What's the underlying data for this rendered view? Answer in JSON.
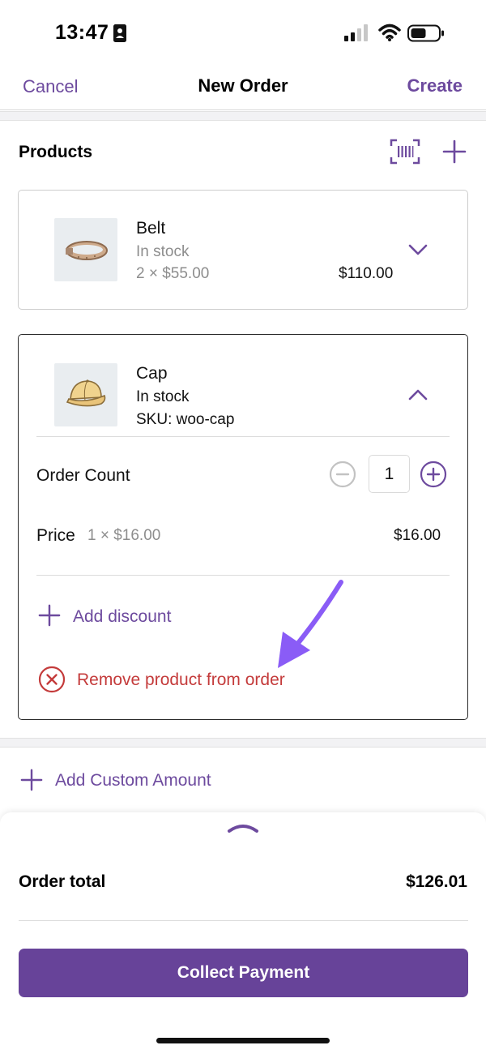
{
  "status_bar": {
    "time": "13:47"
  },
  "nav": {
    "cancel_label": "Cancel",
    "title": "New Order",
    "create_label": "Create"
  },
  "products": {
    "title": "Products",
    "items": [
      {
        "name": "Belt",
        "stock": "In stock",
        "qty_price": "2 × $55.00",
        "line_total": "$110.00"
      },
      {
        "name": "Cap",
        "stock": "In stock",
        "sku": "SKU: woo-cap"
      }
    ],
    "expanded": {
      "order_count_label": "Order Count",
      "order_count_value": "1",
      "price_label": "Price",
      "price_detail": "1 × $16.00",
      "price_total": "$16.00",
      "add_discount_label": "Add discount",
      "remove_label": "Remove product from order"
    }
  },
  "custom_amount_label": "Add Custom Amount",
  "summary": {
    "order_total_label": "Order total",
    "order_total_value": "$126.01",
    "collect_label": "Collect Payment"
  },
  "colors": {
    "accent": "#6d4a9e",
    "button": "#674399",
    "danger": "#c43b3b",
    "arrow": "#8a5cf6"
  },
  "icons": [
    "id-card-icon",
    "cellular-signal-icon",
    "wifi-icon",
    "battery-icon",
    "barcode-scan-icon",
    "plus-icon",
    "chevron-down-icon",
    "chevron-up-icon",
    "minus-circle-icon",
    "plus-circle-icon",
    "remove-circle-icon"
  ]
}
